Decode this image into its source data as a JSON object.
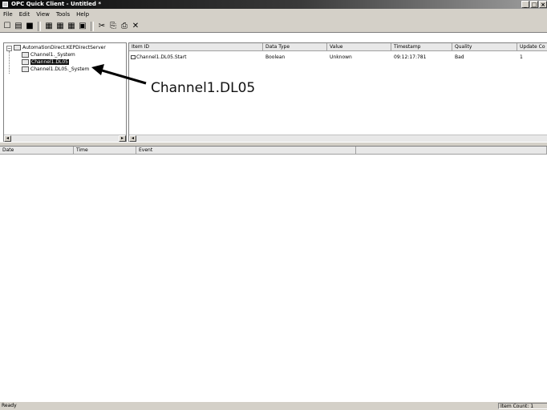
{
  "window": {
    "title": "OPC Quick Client - Untitled *",
    "controls": [
      "_",
      "□",
      "×"
    ]
  },
  "menu": {
    "items": [
      "File",
      "Edit",
      "View",
      "Tools",
      "Help"
    ]
  },
  "toolbar": {
    "icons": [
      "new-icon",
      "open-icon",
      "save-icon",
      "new-server-icon",
      "new-group-icon",
      "new-item-icon",
      "properties-icon",
      "cut-icon",
      "copy-icon",
      "paste-icon",
      "delete-icon"
    ],
    "glyphs": [
      "☐",
      "▤",
      "■",
      "▦",
      "▦",
      "▦",
      "▣",
      "✂",
      "⎘",
      "⎙",
      "✕"
    ]
  },
  "tree": {
    "server": "AutomationDirect.KEPDirectServer",
    "groups": [
      "Channel1._System",
      "Channel1.DL05",
      "Channel1.DL05._System"
    ],
    "selected_index": 1
  },
  "item_list": {
    "columns": [
      "Item ID",
      "Data Type",
      "Value",
      "Timestamp",
      "Quality",
      "Update Co"
    ],
    "rows": [
      [
        "Channel1.DL05.Start",
        "Boolean",
        "Unknown",
        "09:12:17:781",
        "Bad",
        "1"
      ]
    ]
  },
  "event_log": {
    "columns": [
      "Date",
      "Time",
      "Event"
    ]
  },
  "status": {
    "left": "Ready",
    "right": "Item Count: 1"
  },
  "annotation": {
    "label": "Channel1.DL05"
  }
}
